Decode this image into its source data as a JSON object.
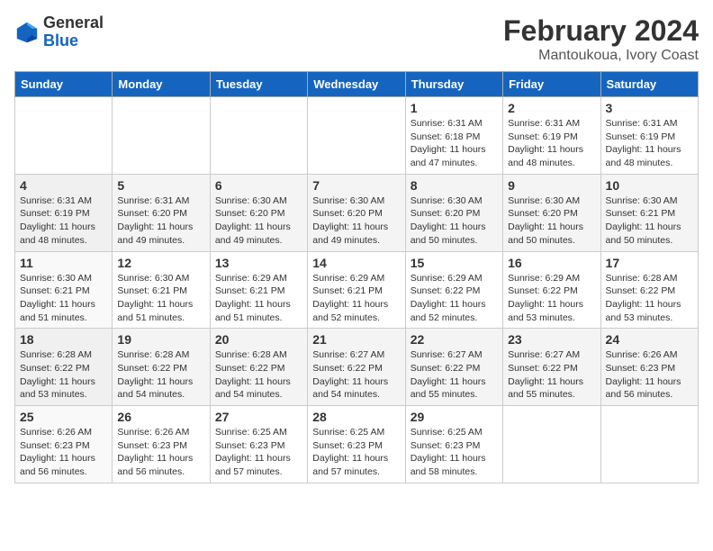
{
  "header": {
    "logo_general": "General",
    "logo_blue": "Blue",
    "month_title": "February 2024",
    "location": "Mantoukoua, Ivory Coast"
  },
  "days_of_week": [
    "Sunday",
    "Monday",
    "Tuesday",
    "Wednesday",
    "Thursday",
    "Friday",
    "Saturday"
  ],
  "weeks": [
    [
      {
        "day": "",
        "sunrise": "",
        "sunset": "",
        "daylight": ""
      },
      {
        "day": "",
        "sunrise": "",
        "sunset": "",
        "daylight": ""
      },
      {
        "day": "",
        "sunrise": "",
        "sunset": "",
        "daylight": ""
      },
      {
        "day": "",
        "sunrise": "",
        "sunset": "",
        "daylight": ""
      },
      {
        "day": "1",
        "sunrise": "Sunrise: 6:31 AM",
        "sunset": "Sunset: 6:18 PM",
        "daylight": "Daylight: 11 hours and 47 minutes."
      },
      {
        "day": "2",
        "sunrise": "Sunrise: 6:31 AM",
        "sunset": "Sunset: 6:19 PM",
        "daylight": "Daylight: 11 hours and 48 minutes."
      },
      {
        "day": "3",
        "sunrise": "Sunrise: 6:31 AM",
        "sunset": "Sunset: 6:19 PM",
        "daylight": "Daylight: 11 hours and 48 minutes."
      }
    ],
    [
      {
        "day": "4",
        "sunrise": "Sunrise: 6:31 AM",
        "sunset": "Sunset: 6:19 PM",
        "daylight": "Daylight: 11 hours and 48 minutes."
      },
      {
        "day": "5",
        "sunrise": "Sunrise: 6:31 AM",
        "sunset": "Sunset: 6:20 PM",
        "daylight": "Daylight: 11 hours and 49 minutes."
      },
      {
        "day": "6",
        "sunrise": "Sunrise: 6:30 AM",
        "sunset": "Sunset: 6:20 PM",
        "daylight": "Daylight: 11 hours and 49 minutes."
      },
      {
        "day": "7",
        "sunrise": "Sunrise: 6:30 AM",
        "sunset": "Sunset: 6:20 PM",
        "daylight": "Daylight: 11 hours and 49 minutes."
      },
      {
        "day": "8",
        "sunrise": "Sunrise: 6:30 AM",
        "sunset": "Sunset: 6:20 PM",
        "daylight": "Daylight: 11 hours and 50 minutes."
      },
      {
        "day": "9",
        "sunrise": "Sunrise: 6:30 AM",
        "sunset": "Sunset: 6:20 PM",
        "daylight": "Daylight: 11 hours and 50 minutes."
      },
      {
        "day": "10",
        "sunrise": "Sunrise: 6:30 AM",
        "sunset": "Sunset: 6:21 PM",
        "daylight": "Daylight: 11 hours and 50 minutes."
      }
    ],
    [
      {
        "day": "11",
        "sunrise": "Sunrise: 6:30 AM",
        "sunset": "Sunset: 6:21 PM",
        "daylight": "Daylight: 11 hours and 51 minutes."
      },
      {
        "day": "12",
        "sunrise": "Sunrise: 6:30 AM",
        "sunset": "Sunset: 6:21 PM",
        "daylight": "Daylight: 11 hours and 51 minutes."
      },
      {
        "day": "13",
        "sunrise": "Sunrise: 6:29 AM",
        "sunset": "Sunset: 6:21 PM",
        "daylight": "Daylight: 11 hours and 51 minutes."
      },
      {
        "day": "14",
        "sunrise": "Sunrise: 6:29 AM",
        "sunset": "Sunset: 6:21 PM",
        "daylight": "Daylight: 11 hours and 52 minutes."
      },
      {
        "day": "15",
        "sunrise": "Sunrise: 6:29 AM",
        "sunset": "Sunset: 6:22 PM",
        "daylight": "Daylight: 11 hours and 52 minutes."
      },
      {
        "day": "16",
        "sunrise": "Sunrise: 6:29 AM",
        "sunset": "Sunset: 6:22 PM",
        "daylight": "Daylight: 11 hours and 53 minutes."
      },
      {
        "day": "17",
        "sunrise": "Sunrise: 6:28 AM",
        "sunset": "Sunset: 6:22 PM",
        "daylight": "Daylight: 11 hours and 53 minutes."
      }
    ],
    [
      {
        "day": "18",
        "sunrise": "Sunrise: 6:28 AM",
        "sunset": "Sunset: 6:22 PM",
        "daylight": "Daylight: 11 hours and 53 minutes."
      },
      {
        "day": "19",
        "sunrise": "Sunrise: 6:28 AM",
        "sunset": "Sunset: 6:22 PM",
        "daylight": "Daylight: 11 hours and 54 minutes."
      },
      {
        "day": "20",
        "sunrise": "Sunrise: 6:28 AM",
        "sunset": "Sunset: 6:22 PM",
        "daylight": "Daylight: 11 hours and 54 minutes."
      },
      {
        "day": "21",
        "sunrise": "Sunrise: 6:27 AM",
        "sunset": "Sunset: 6:22 PM",
        "daylight": "Daylight: 11 hours and 54 minutes."
      },
      {
        "day": "22",
        "sunrise": "Sunrise: 6:27 AM",
        "sunset": "Sunset: 6:22 PM",
        "daylight": "Daylight: 11 hours and 55 minutes."
      },
      {
        "day": "23",
        "sunrise": "Sunrise: 6:27 AM",
        "sunset": "Sunset: 6:22 PM",
        "daylight": "Daylight: 11 hours and 55 minutes."
      },
      {
        "day": "24",
        "sunrise": "Sunrise: 6:26 AM",
        "sunset": "Sunset: 6:23 PM",
        "daylight": "Daylight: 11 hours and 56 minutes."
      }
    ],
    [
      {
        "day": "25",
        "sunrise": "Sunrise: 6:26 AM",
        "sunset": "Sunset: 6:23 PM",
        "daylight": "Daylight: 11 hours and 56 minutes."
      },
      {
        "day": "26",
        "sunrise": "Sunrise: 6:26 AM",
        "sunset": "Sunset: 6:23 PM",
        "daylight": "Daylight: 11 hours and 56 minutes."
      },
      {
        "day": "27",
        "sunrise": "Sunrise: 6:25 AM",
        "sunset": "Sunset: 6:23 PM",
        "daylight": "Daylight: 11 hours and 57 minutes."
      },
      {
        "day": "28",
        "sunrise": "Sunrise: 6:25 AM",
        "sunset": "Sunset: 6:23 PM",
        "daylight": "Daylight: 11 hours and 57 minutes."
      },
      {
        "day": "29",
        "sunrise": "Sunrise: 6:25 AM",
        "sunset": "Sunset: 6:23 PM",
        "daylight": "Daylight: 11 hours and 58 minutes."
      },
      {
        "day": "",
        "sunrise": "",
        "sunset": "",
        "daylight": ""
      },
      {
        "day": "",
        "sunrise": "",
        "sunset": "",
        "daylight": ""
      }
    ]
  ]
}
